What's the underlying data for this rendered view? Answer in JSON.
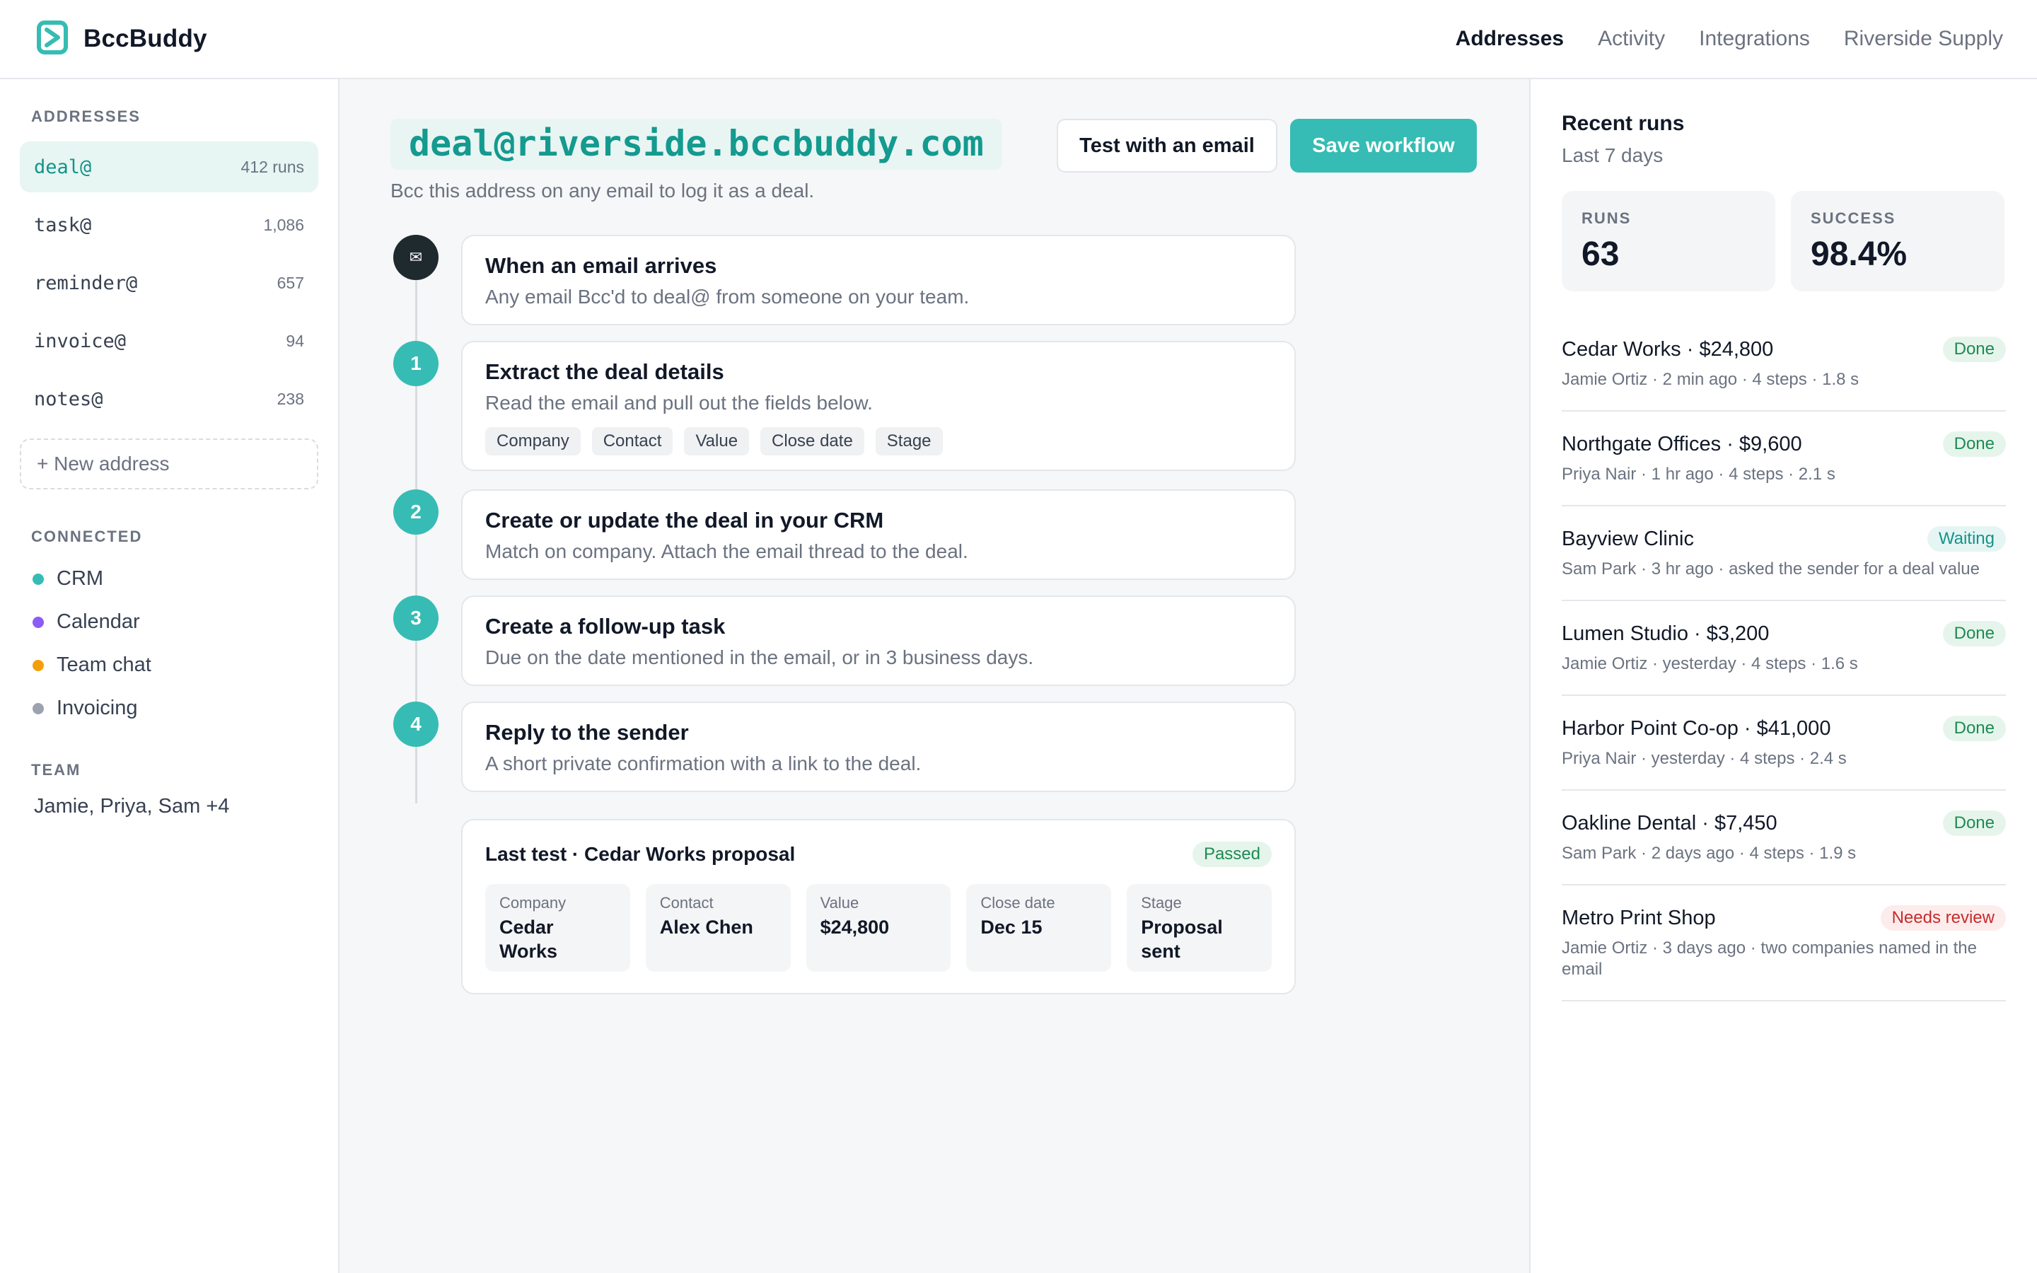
{
  "brand": {
    "name": "BccBuddy",
    "accent": "#36bcb4"
  },
  "nav": {
    "items": [
      {
        "label": "Addresses",
        "active": true
      },
      {
        "label": "Activity",
        "active": false
      },
      {
        "label": "Integrations",
        "active": false
      },
      {
        "label": "Riverside Supply",
        "active": false
      }
    ]
  },
  "sidebar": {
    "addresses_heading": "ADDRESSES",
    "addresses": [
      {
        "name": "deal@",
        "count": "412 runs",
        "active": true
      },
      {
        "name": "task@",
        "count": "1,086",
        "active": false
      },
      {
        "name": "reminder@",
        "count": "657",
        "active": false
      },
      {
        "name": "invoice@",
        "count": "94",
        "active": false
      },
      {
        "name": "notes@",
        "count": "238",
        "active": false
      }
    ],
    "new_address": "+ New address",
    "connected_heading": "CONNECTED",
    "connected": [
      {
        "label": "CRM",
        "color": "#36bcb4"
      },
      {
        "label": "Calendar",
        "color": "#8b5cf6"
      },
      {
        "label": "Team chat",
        "color": "#f59e0b"
      },
      {
        "label": "Invoicing",
        "color": "#9ca3af"
      }
    ],
    "team_heading": "TEAM",
    "team": "Jamie, Priya, Sam +4"
  },
  "main": {
    "address": "deal@riverside.bccbuddy.com",
    "subtitle": "Bcc this address on any email to log it as a deal.",
    "test_button": "Test with an email",
    "save_button": "Save workflow",
    "trigger": {
      "icon": "envelope-icon",
      "glyph": "✉",
      "title": "When an email arrives",
      "desc": "Any email Bcc'd to deal@ from someone on your team."
    },
    "steps": [
      {
        "num": "1",
        "title": "Extract the deal details",
        "desc": "Read the email and pull out the fields below.",
        "chips": [
          "Company",
          "Contact",
          "Value",
          "Close date",
          "Stage"
        ]
      },
      {
        "num": "2",
        "title": "Create or update the deal in your CRM",
        "desc": "Match on company. Attach the email thread to the deal."
      },
      {
        "num": "3",
        "title": "Create a follow-up task",
        "desc": "Due on the date mentioned in the email, or in 3 business days."
      },
      {
        "num": "4",
        "title": "Reply to the sender",
        "desc": "A short private confirmation with a link to the deal."
      }
    ],
    "last_test": {
      "title": "Last test · Cedar Works proposal",
      "status": "Passed",
      "fields": [
        {
          "label": "Company",
          "value": "Cedar Works"
        },
        {
          "label": "Contact",
          "value": "Alex Chen"
        },
        {
          "label": "Value",
          "value": "$24,800"
        },
        {
          "label": "Close date",
          "value": "Dec 15"
        },
        {
          "label": "Stage",
          "value": "Proposal sent"
        }
      ]
    }
  },
  "recent": {
    "title": "Recent runs",
    "subtitle": "Last 7 days",
    "stats": [
      {
        "label": "RUNS",
        "value": "63"
      },
      {
        "label": "SUCCESS",
        "value": "98.4%"
      }
    ],
    "runs": [
      {
        "name": "Cedar Works · $24,800",
        "meta": "Jamie Ortiz · 2 min ago · 4 steps · 1.8 s",
        "status": "Done",
        "kind": "done"
      },
      {
        "name": "Northgate Offices · $9,600",
        "meta": "Priya Nair · 1 hr ago · 4 steps · 2.1 s",
        "status": "Done",
        "kind": "done"
      },
      {
        "name": "Bayview Clinic",
        "meta": "Sam Park · 3 hr ago · asked the sender for a deal value",
        "status": "Waiting",
        "kind": "waiting"
      },
      {
        "name": "Lumen Studio · $3,200",
        "meta": "Jamie Ortiz · yesterday · 4 steps · 1.6 s",
        "status": "Done",
        "kind": "done"
      },
      {
        "name": "Harbor Point Co-op · $41,000",
        "meta": "Priya Nair · yesterday · 4 steps · 2.4 s",
        "status": "Done",
        "kind": "done"
      },
      {
        "name": "Oakline Dental · $7,450",
        "meta": "Sam Park · 2 days ago · 4 steps · 1.9 s",
        "status": "Done",
        "kind": "done"
      },
      {
        "name": "Metro Print Shop",
        "meta": "Jamie Ortiz · 3 days ago · two companies named in the email",
        "status": "Needs review",
        "kind": "review"
      }
    ]
  }
}
